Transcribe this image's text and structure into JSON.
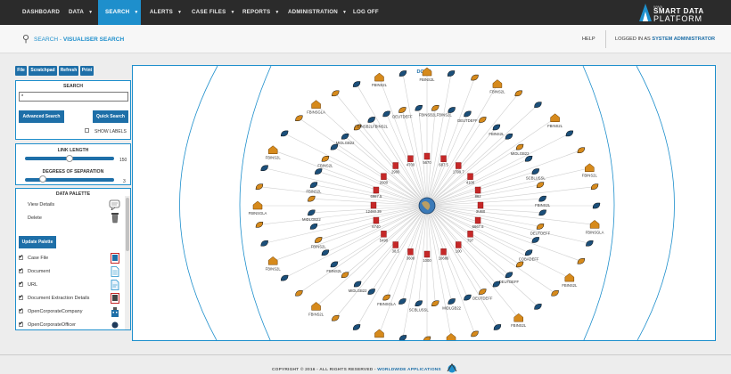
{
  "nav": {
    "items": [
      {
        "label": "DASHBOARD",
        "dropdown": false
      },
      {
        "label": "DATA",
        "dropdown": true
      },
      {
        "label": "SEARCH",
        "dropdown": true,
        "active": true
      },
      {
        "label": "ALERTS",
        "dropdown": true
      },
      {
        "label": "CASE FILES",
        "dropdown": true
      },
      {
        "label": "REPORTS",
        "dropdown": true
      },
      {
        "label": "ADMINISTRATION",
        "dropdown": true
      },
      {
        "label": "LOG OFF",
        "dropdown": false
      }
    ],
    "logo": {
      "line_small": "WWA",
      "line1": "SMART DATA",
      "line2": "PLATFORM"
    }
  },
  "header": {
    "breadcrumb_prefix": "SEARCH - ",
    "breadcrumb_title": "VISUALISER SEARCH",
    "help": "HELP",
    "logged_prefix": "LOGGED IN AS ",
    "logged_user": "SYSTEM ADMINISTRATOR"
  },
  "toolbar": {
    "file": "File",
    "scratchpad": "Scratchpad",
    "refresh": "Refresh",
    "print": "Print"
  },
  "search": {
    "title": "SEARCH",
    "value": "*",
    "advanced": "Advanced Search",
    "quick": "Quick Search",
    "show_labels": "SHOW LABELS"
  },
  "link": {
    "title": "LINK LENGTH",
    "value": "150",
    "fraction": 0.5,
    "degrees_title": "DEGREES OF SEPARATION",
    "degrees_value": "3",
    "degrees_fraction": 0.2
  },
  "palette": {
    "title": "DATA PALETTE",
    "view_details": "View Details",
    "delete": "Delete",
    "update": "Update Palette",
    "items": [
      {
        "label": "Case File",
        "checked": true,
        "icon": "case-file-icon"
      },
      {
        "label": "Document",
        "checked": true,
        "icon": "document-icon"
      },
      {
        "label": "URL",
        "checked": true,
        "icon": "url-icon"
      },
      {
        "label": "Document Extraction Details",
        "checked": true,
        "icon": "extraction-icon"
      },
      {
        "label": "OpenCorporateCompany",
        "checked": true,
        "icon": "company-icon"
      },
      {
        "label": "OpenCorporateOfficer",
        "checked": true,
        "icon": "officer-icon"
      }
    ]
  },
  "graph": {
    "status": "DONE",
    "colors": {
      "blue": "#1b4f7a",
      "orange": "#d68a1c",
      "red": "#c62828",
      "line": "#cfcfcf",
      "ring": "#1e8fcc"
    },
    "inner": [
      "5670",
      "687.5",
      "1799.7",
      "4100",
      "882",
      "3UB0",
      "6667.5",
      "797",
      "100",
      "10686",
      "1000",
      "3600",
      "38.5",
      "5490",
      "6740",
      "12460.39",
      "6987.5",
      "2000",
      "2900",
      "4700"
    ],
    "outer_labels": [
      "FBINS2L",
      "FBINS2L",
      "FBINS2L",
      "FBINS2L",
      "FBINSGLA",
      "FBINS2L",
      "FBINS2L",
      "FBINSGLA",
      "FBINS2L",
      "FBINS2L",
      "FBINS2L",
      "FBINSGLA",
      "FBINS2L",
      "FBINSGLA"
    ],
    "mid_labels": [
      "FBINSB2LFBINS2L",
      "DEUTDEFF",
      "FBINS2L",
      "MIDLGB22",
      "SCBLUSSL",
      "FBINS2L",
      "DEUTDEFF",
      "COBADEFF",
      "DEUTDEFF",
      "DEUTDEFF",
      "MIDLGB22",
      "SCBLUSSL",
      "FBINSGLA",
      "MIDLGB22",
      "FBINS2L",
      "FBINS2L",
      "MIDLGB22",
      "FBINS2L",
      "FBINS2L",
      "MIDLGB22"
    ]
  },
  "footer": {
    "copyright": "COPYRIGHT © 2016 - ALL RIGHTS RESERVED - ",
    "brand": "WORLDWIDE APPLICATIONS"
  }
}
